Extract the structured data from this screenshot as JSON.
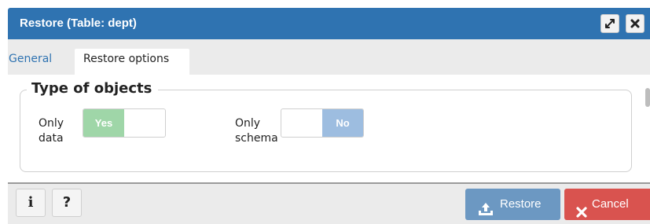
{
  "dialog": {
    "title": "Restore (Table: dept)",
    "window_buttons": [
      "maximize-icon",
      "close-icon"
    ]
  },
  "tabs": [
    {
      "label": "General",
      "active": false
    },
    {
      "label": "Restore options",
      "active": true
    }
  ],
  "section": {
    "legend": "Type of objects",
    "fields": [
      {
        "label": "Only data",
        "toggle_on_label": "Yes",
        "value": true
      },
      {
        "label": "Only schema",
        "toggle_off_label": "No",
        "value": false
      }
    ]
  },
  "footer": {
    "info_label": "i",
    "help_label": "?",
    "restore_label": "Restore",
    "cancel_label": "Cancel"
  },
  "colors": {
    "title_bar": "#2f73b1",
    "toggle_yes": "#9fd6a8",
    "toggle_no": "#9dbde0",
    "restore_button": "#6c98c2",
    "cancel_button": "#d9534f",
    "tab_link": "#2f73b1"
  }
}
